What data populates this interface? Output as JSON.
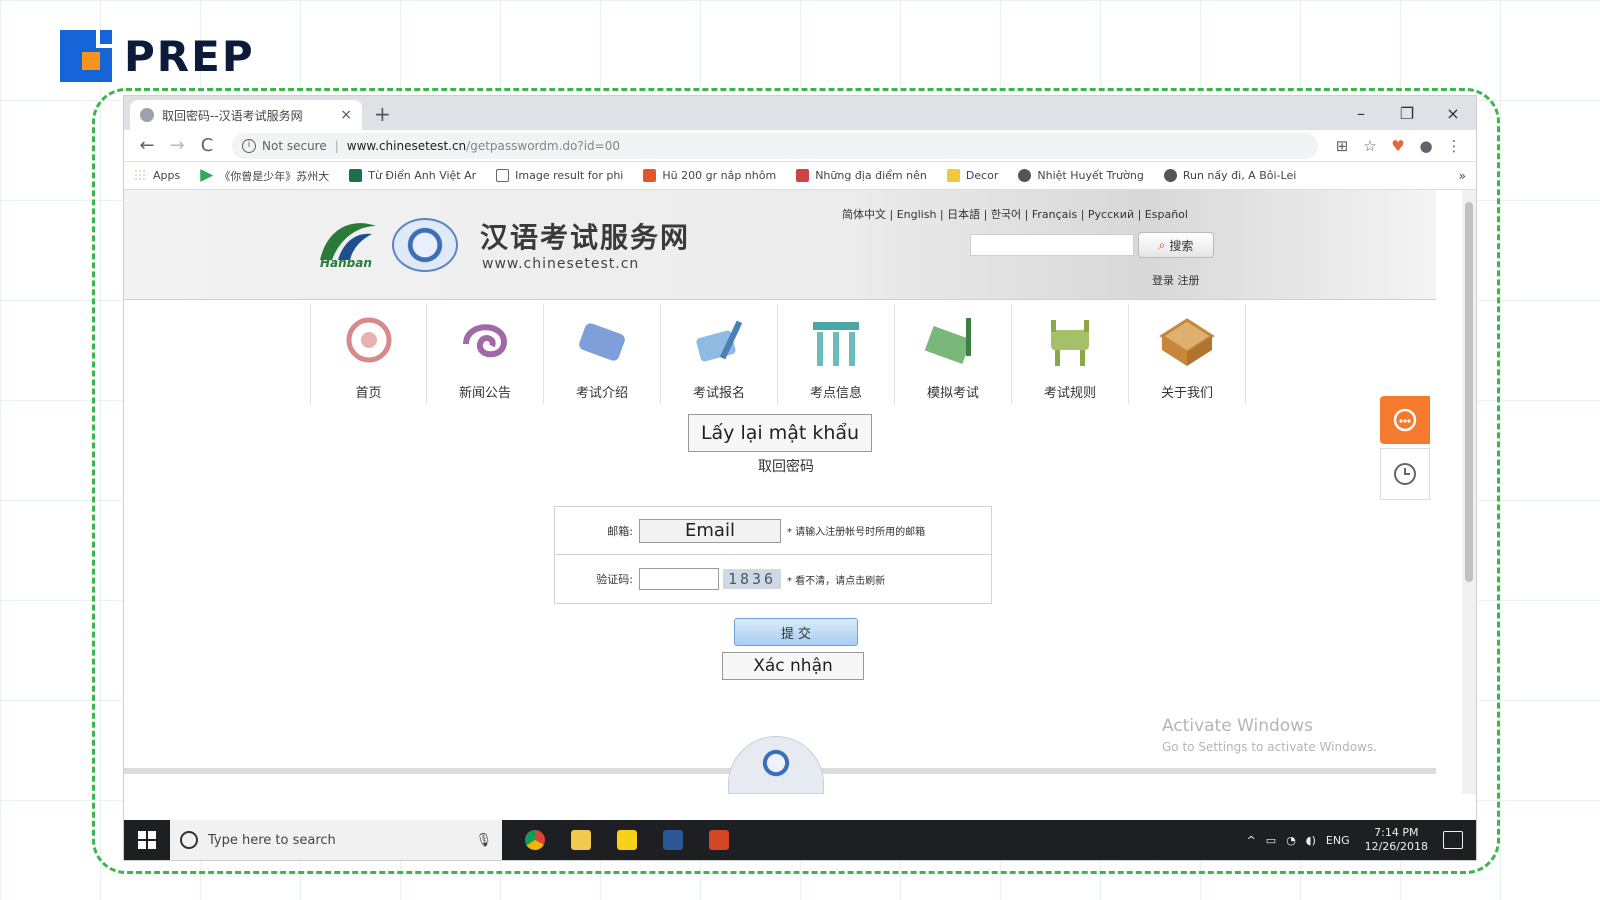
{
  "brand": {
    "name": "PREP",
    "blue": "#1565d8",
    "orange": "#f7941d",
    "frame_green": "#3cb54a"
  },
  "browser": {
    "tab_title": "取回密码--汉语考试服务网",
    "tab_close": "×",
    "new_tab": "+",
    "controls": {
      "minimize": "–",
      "maximize": "❐",
      "close": "×"
    },
    "nav": {
      "back": "←",
      "forward": "→",
      "reload": "C"
    },
    "security": "Not secure",
    "url_host": "www.chinesetest.cn",
    "url_path": "/getpasswordm.do?id=00",
    "icons": [
      "translate-icon",
      "star-icon",
      "extension-icon",
      "profile-icon",
      "menu-icon"
    ],
    "bookmarks": [
      {
        "label": "Apps",
        "color": "#e0592a"
      },
      {
        "label": "《你曾是少年》苏州大",
        "color": "#2eaa55"
      },
      {
        "label": "Từ Điển Anh Việt Ar",
        "color": "#1f6f4a"
      },
      {
        "label": "Image result for phi",
        "color": "#ffffff"
      },
      {
        "label": "Hũ 200 gr nắp nhôm",
        "color": "#e2572a"
      },
      {
        "label": "Những địa điểm nên",
        "color": "#c44"
      },
      {
        "label": "Decor",
        "color": "#f3c73a"
      },
      {
        "label": "Nhiệt Huyết Trường",
        "color": "#555"
      },
      {
        "label": "Run nấy đi, A Bôi-Lei",
        "color": "#555"
      }
    ],
    "bookmarks_more": "»"
  },
  "site": {
    "logo_text": "Hanban",
    "name": "汉语考试服务网",
    "url": "www.chinesetest.cn",
    "languages": "简体中文 | English | 日本語 | 한국어 | Français | Русский | Español",
    "search_button": "搜索",
    "login_links": "登录  注册",
    "nav": [
      {
        "label": "首页",
        "color": "#d88a8a"
      },
      {
        "label": "新闻公告",
        "color": "#a06aa8"
      },
      {
        "label": "考试介绍",
        "color": "#5a7fc4"
      },
      {
        "label": "考试报名",
        "color": "#6a9ed6"
      },
      {
        "label": "考点信息",
        "color": "#4aa7a8"
      },
      {
        "label": "模拟考试",
        "color": "#5aa05a"
      },
      {
        "label": "考试规则",
        "color": "#8aa848"
      },
      {
        "label": "关于我们",
        "color": "#c8863a"
      }
    ]
  },
  "page": {
    "title_vi": "Lấy lại mật khẩu",
    "title_cn": "取回密码",
    "form": {
      "email_label": "邮箱:",
      "email_overlay": "Email",
      "email_note": "* 请输入注册帐号时所用的邮箱",
      "code_label": "验证码:",
      "code_value": "",
      "captcha": "1836",
      "code_note": "* 看不清，请点击刷新"
    },
    "submit_label": "提 交",
    "confirm_label": "Xác nhận"
  },
  "overlay": {
    "activate_title": "Activate Windows",
    "activate_sub": "Go to Settings to activate Windows."
  },
  "taskbar": {
    "search_placeholder": "Type here to search",
    "apps": [
      {
        "name": "chrome",
        "color": "#f4b400"
      },
      {
        "name": "file-explorer",
        "color": "#f2c94c"
      },
      {
        "name": "sticky-notes",
        "color": "#f7d11a"
      },
      {
        "name": "word",
        "color": "#2b5797"
      },
      {
        "name": "powerpoint",
        "color": "#d24726"
      }
    ],
    "tray_chevron": "^",
    "lang": "ENG",
    "time": "7:14 PM",
    "date": "12/26/2018"
  }
}
